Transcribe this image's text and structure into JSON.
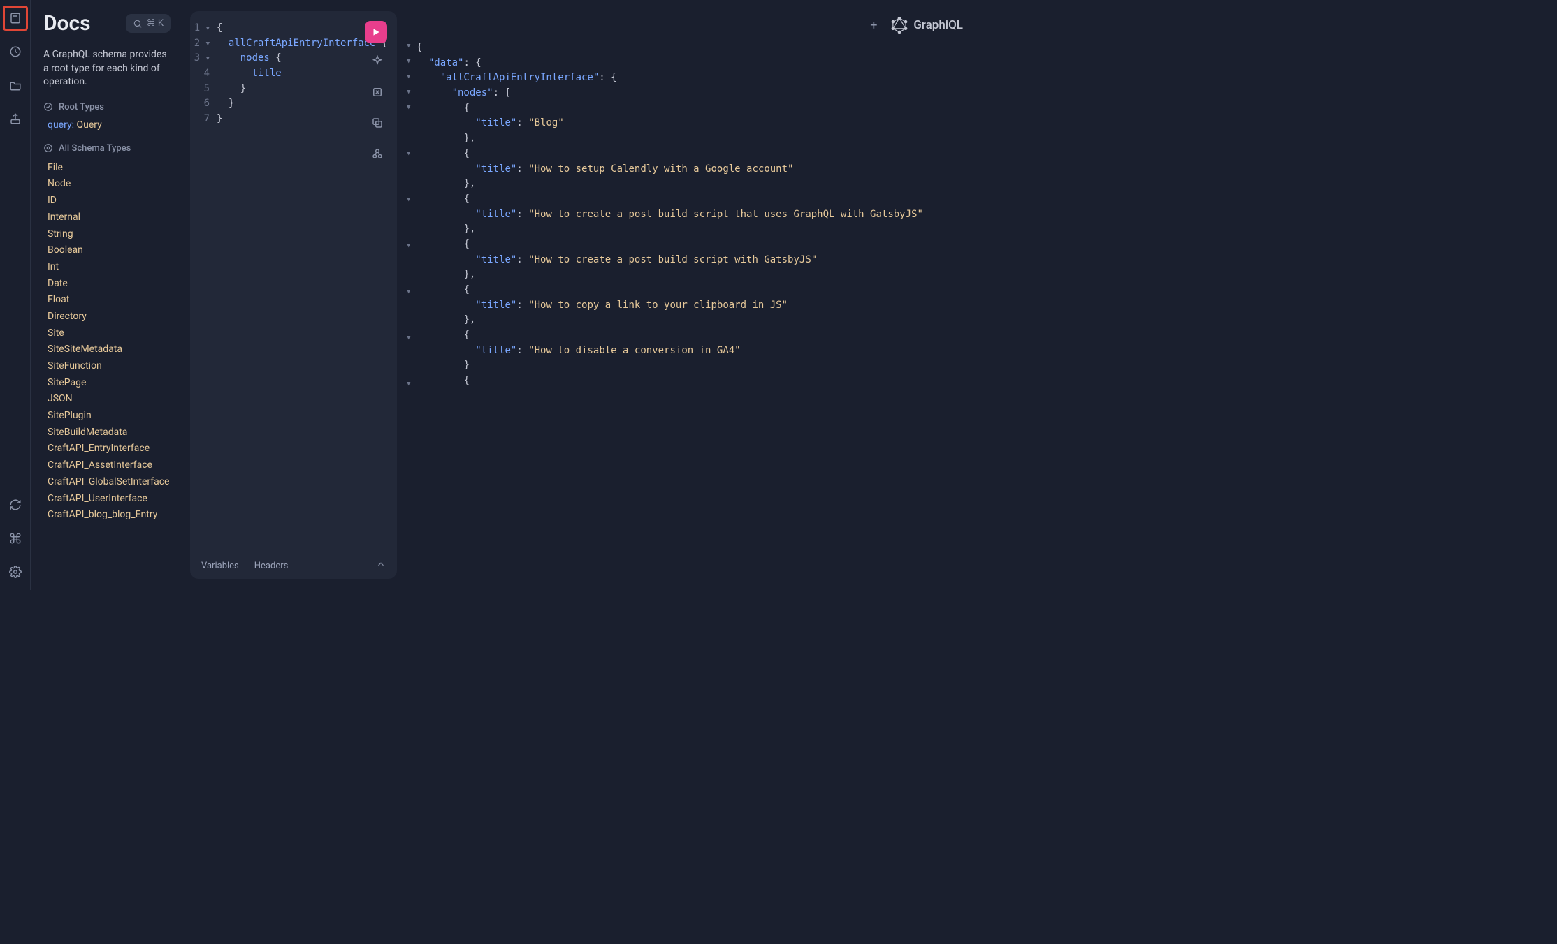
{
  "rail_icons": {
    "docs": "book-icon",
    "history": "history-icon",
    "explorer": "folder-icon",
    "share": "share-icon",
    "refetch": "refresh-icon",
    "shortcuts": "command-icon",
    "settings": "gear-icon"
  },
  "docs": {
    "title": "Docs",
    "search_hint": "⌘ K",
    "description": "A GraphQL schema provides a root type for each kind of operation.",
    "root_types_label": "Root Types",
    "root_type": {
      "label": "query:",
      "value": "Query"
    },
    "all_schema_label": "All Schema Types",
    "schema_types": [
      "File",
      "Node",
      "ID",
      "Internal",
      "String",
      "Boolean",
      "Int",
      "Date",
      "Float",
      "Directory",
      "Site",
      "SiteSiteMetadata",
      "SiteFunction",
      "SitePage",
      "JSON",
      "SitePlugin",
      "SiteBuildMetadata",
      "CraftAPI_EntryInterface",
      "CraftAPI_AssetInterface",
      "CraftAPI_GlobalSetInterface",
      "CraftAPI_UserInterface",
      "CraftAPI_blog_blog_Entry"
    ]
  },
  "editor": {
    "lines": [
      {
        "n": "1",
        "fold": true,
        "indent": 0,
        "tokens": [
          [
            "{",
            "brace"
          ]
        ]
      },
      {
        "n": "2",
        "fold": true,
        "indent": 1,
        "tokens": [
          [
            "allCraftApiEntryInterface",
            "func"
          ],
          [
            " {",
            "brace"
          ]
        ]
      },
      {
        "n": "3",
        "fold": true,
        "indent": 2,
        "tokens": [
          [
            "nodes",
            "field"
          ],
          [
            " {",
            "brace"
          ]
        ]
      },
      {
        "n": "4",
        "fold": false,
        "indent": 3,
        "tokens": [
          [
            "title",
            "field"
          ]
        ]
      },
      {
        "n": "5",
        "fold": false,
        "indent": 2,
        "tokens": [
          [
            "}",
            "brace"
          ]
        ]
      },
      {
        "n": "6",
        "fold": false,
        "indent": 1,
        "tokens": [
          [
            "}",
            "brace"
          ]
        ]
      },
      {
        "n": "7",
        "fold": false,
        "indent": 0,
        "tokens": [
          [
            "}",
            "brace"
          ]
        ]
      }
    ],
    "variables_tab": "Variables",
    "headers_tab": "Headers"
  },
  "header": {
    "add_label": "+",
    "brand": "GraphiQL"
  },
  "response": {
    "data": {
      "allCraftApiEntryInterface": {
        "nodes": [
          {
            "title": "Blog"
          },
          {
            "title": "How to setup Calendly with a Google account"
          },
          {
            "title": "How to create a post build script that uses GraphQL with GatsbyJS"
          },
          {
            "title": "How to create a post build script with GatsbyJS"
          },
          {
            "title": "How to copy a link to your clipboard in JS"
          },
          {
            "title": "How to disable a conversion in GA4"
          }
        ]
      }
    }
  }
}
